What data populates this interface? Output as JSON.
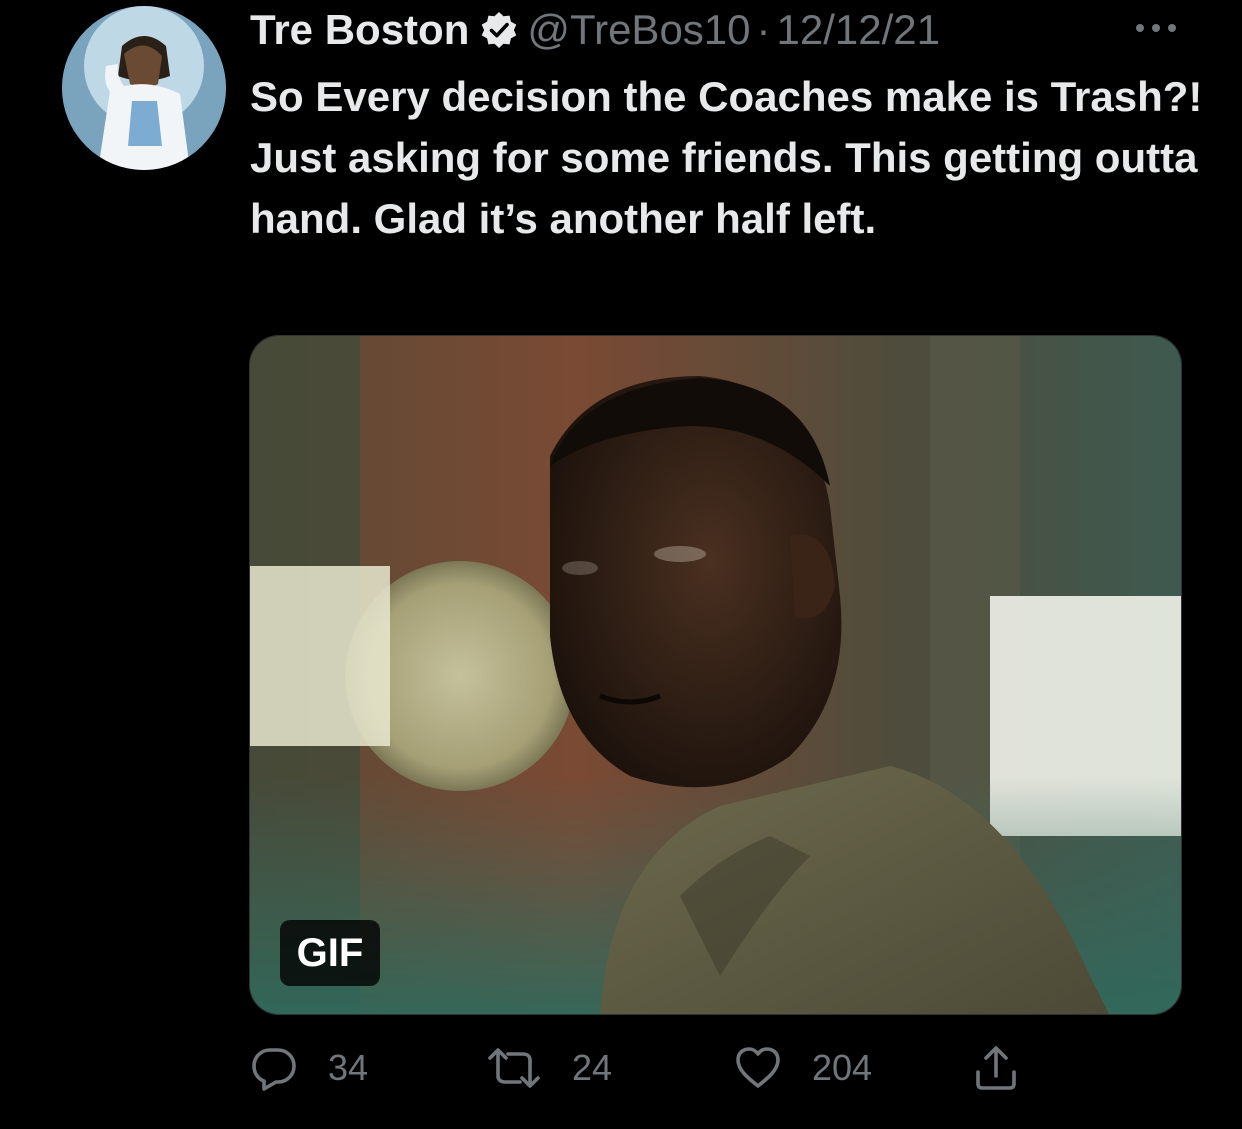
{
  "tweet": {
    "author": {
      "display_name": "Tre Boston",
      "handle": "@TreBos10",
      "verified": true
    },
    "separator": "·",
    "date": "12/12/21",
    "text": "So Every decision the Coaches make is Trash?! Just asking for some friends. This getting outta hand. Glad it’s another half left.",
    "media": {
      "type": "gif",
      "badge": "GIF"
    },
    "actions": {
      "reply": {
        "icon": "reply-icon",
        "count": "34"
      },
      "retweet": {
        "icon": "retweet-icon",
        "count": "24"
      },
      "like": {
        "icon": "heart-icon",
        "count": "204"
      },
      "share": {
        "icon": "share-icon"
      }
    }
  },
  "colors": {
    "background": "#000000",
    "primary_text": "#e7e9ea",
    "secondary_text": "#71767b"
  }
}
